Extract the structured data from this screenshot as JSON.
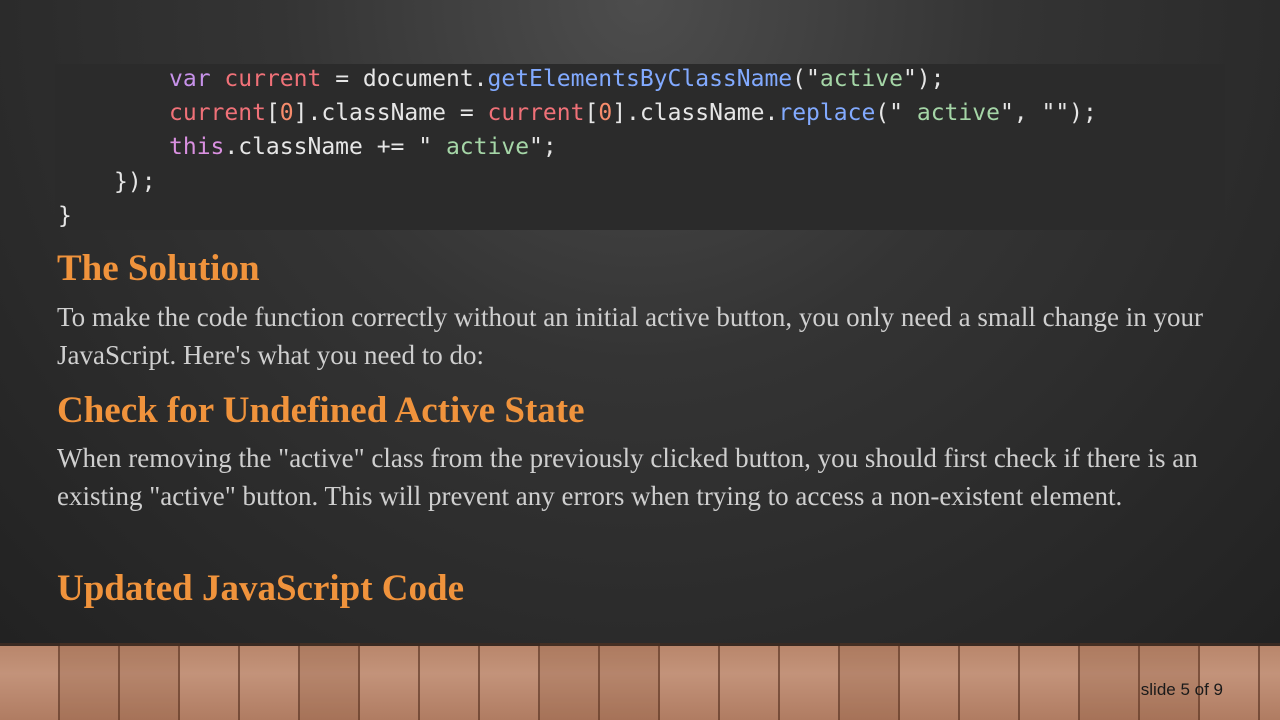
{
  "code": {
    "lines": [
      {
        "tokens": [
          {
            "t": "kw",
            "v": "var"
          },
          {
            "t": "plain",
            "v": " "
          },
          {
            "t": "var",
            "v": "current"
          },
          {
            "t": "plain",
            "v": " = document."
          },
          {
            "t": "fn",
            "v": "getElementsByClassName"
          },
          {
            "t": "plain",
            "v": "(\""
          },
          {
            "t": "str",
            "v": "active"
          },
          {
            "t": "plain",
            "v": "\");"
          }
        ]
      },
      {
        "tokens": [
          {
            "t": "var",
            "v": "current"
          },
          {
            "t": "plain",
            "v": "["
          },
          {
            "t": "num",
            "v": "0"
          },
          {
            "t": "plain",
            "v": "].className = "
          },
          {
            "t": "var",
            "v": "current"
          },
          {
            "t": "plain",
            "v": "["
          },
          {
            "t": "num",
            "v": "0"
          },
          {
            "t": "plain",
            "v": "].className."
          },
          {
            "t": "fn",
            "v": "replace"
          },
          {
            "t": "plain",
            "v": "(\" "
          },
          {
            "t": "str",
            "v": "active"
          },
          {
            "t": "plain",
            "v": "\", \"\");"
          }
        ]
      },
      {
        "tokens": [
          {
            "t": "kw2",
            "v": "this"
          },
          {
            "t": "plain",
            "v": ".className += \" "
          },
          {
            "t": "str",
            "v": "active"
          },
          {
            "t": "plain",
            "v": "\";"
          }
        ]
      },
      {
        "tokens": [
          {
            "t": "plain",
            "v": "});"
          }
        ]
      },
      {
        "tokens": [
          {
            "t": "plain",
            "v": "}"
          }
        ]
      }
    ]
  },
  "sections": {
    "solution_heading": "The Solution",
    "solution_text": "To make the code function correctly without an initial active button, you only need a small change in your JavaScript. Here's what you need to do:",
    "check_heading": "Check for Undefined Active State",
    "check_text": "When removing the \"active\" class from the previously clicked button, you should first check if there is an existing \"active\" button. This will prevent any errors when trying to access a non-existent element.",
    "updated_heading": "Updated JavaScript Code"
  },
  "footer": {
    "slide_number": "slide 5 of 9"
  },
  "colors": {
    "heading": "#f0933c",
    "body_text": "#cfcfcf",
    "code_bg": "#2b2b2b"
  }
}
